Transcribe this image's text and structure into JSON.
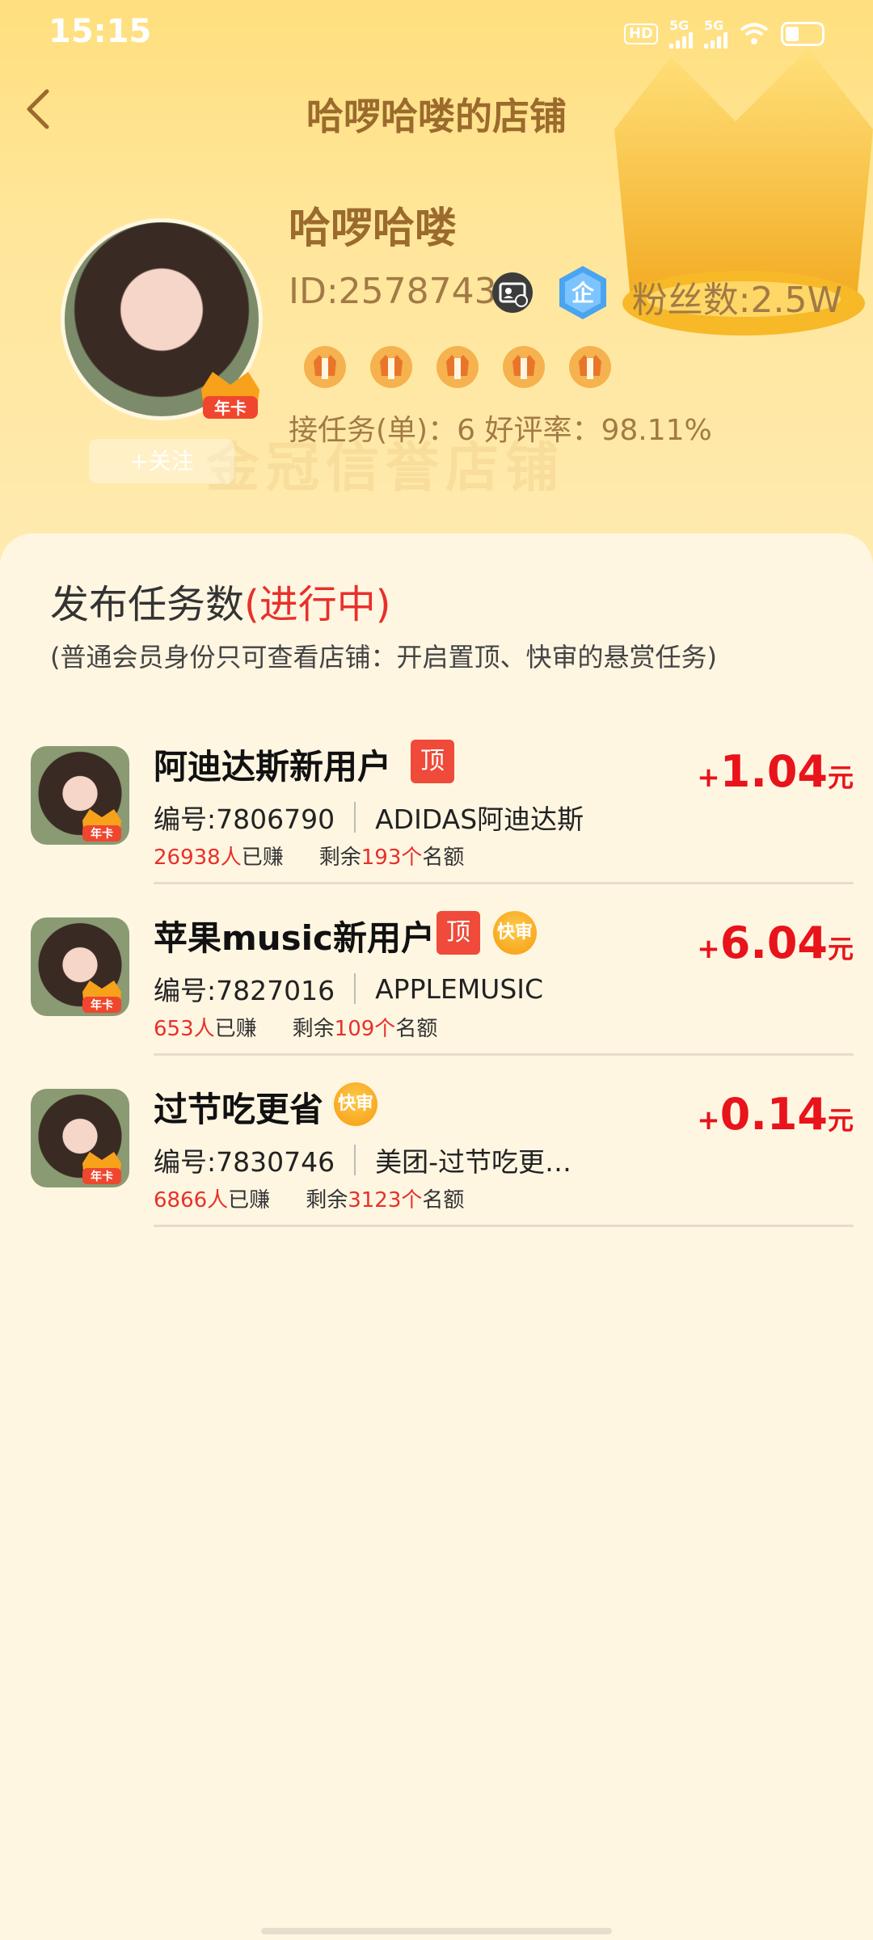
{
  "status_bar": {
    "time": "15:15",
    "hd_label": "HD",
    "network_1": "5G",
    "network_2": "5G",
    "icons": [
      "hd-voice-icon",
      "signal-icon",
      "signal-icon",
      "wifi-icon",
      "battery-icon"
    ]
  },
  "header": {
    "title": "哈啰哈喽的店铺",
    "back_icon": "chevron-left-icon",
    "watermark": "金冠信誉店铺",
    "shop_name": "哈啰哈喽",
    "id_text": "ID:2578743",
    "fans_text": "粉丝数:2.5W",
    "avatar_badge": "年卡",
    "follow_label": "+关注",
    "medal_count": 5,
    "stats_text": "接任务(单)：6   好评率：98.11%",
    "enterprise_badge": "企"
  },
  "tasks_section": {
    "title_main": "发布任务数",
    "title_status": "(进行中)",
    "note": "(普通会员身份只可查看店铺：开启置顶、快审的悬赏任务)"
  },
  "tasks": [
    {
      "title": "阿迪达斯新用户",
      "tags": {
        "top": "顶",
        "fast": ""
      },
      "code": "编号:7806790",
      "brand": "ADIDAS阿迪达斯",
      "earned_count": "26938人",
      "earned_label": "已赚",
      "remain_prefix": "剩余",
      "remain_count": "193个",
      "remain_suffix": "名额",
      "price_plus": "+",
      "price": "1.04",
      "price_unit": "元",
      "thumb_badge": "年卡"
    },
    {
      "title": "苹果music新用户",
      "tags": {
        "top": "顶",
        "fast": "快审"
      },
      "code": "编号:7827016",
      "brand": "APPLEMUSIC",
      "earned_count": "653人",
      "earned_label": "已赚",
      "remain_prefix": "剩余",
      "remain_count": "109个",
      "remain_suffix": "名额",
      "price_plus": "+",
      "price": "6.04",
      "price_unit": "元",
      "thumb_badge": "年卡"
    },
    {
      "title": "过节吃更省",
      "tags": {
        "top": "",
        "fast": "快审"
      },
      "code": "编号:7830746",
      "brand": "美团-过节吃更…",
      "earned_count": "6866人",
      "earned_label": "已赚",
      "remain_prefix": "剩余",
      "remain_count": "3123个",
      "remain_suffix": "名额",
      "price_plus": "+",
      "price": "0.14",
      "price_unit": "元",
      "thumb_badge": "年卡"
    }
  ],
  "colors": {
    "accent_red": "#e8131b",
    "brown_text": "#9b6a2d",
    "header_gold": "#ffdf7e",
    "page_bg": "#fff6e2"
  }
}
